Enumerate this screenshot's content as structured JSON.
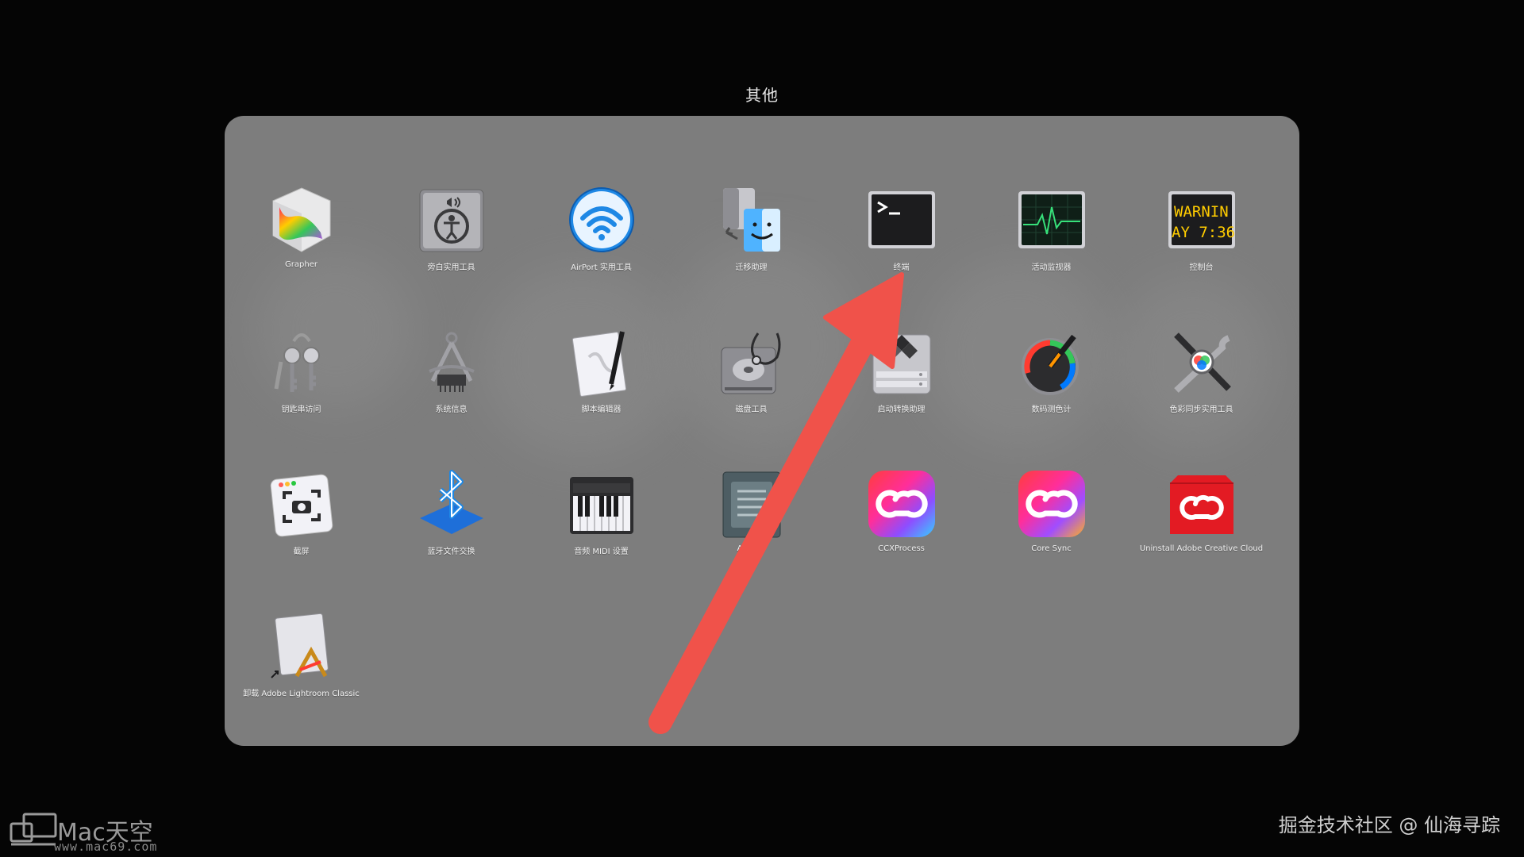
{
  "folder": {
    "title": "其他"
  },
  "apps": [
    {
      "label": "Grapher",
      "icon": "grapher-icon"
    },
    {
      "label": "旁白实用工具",
      "icon": "voiceover-utility-icon"
    },
    {
      "label": "AirPort 实用工具",
      "icon": "airport-utility-icon"
    },
    {
      "label": "迁移助理",
      "icon": "migration-assistant-icon"
    },
    {
      "label": "终端",
      "icon": "terminal-icon"
    },
    {
      "label": "活动监视器",
      "icon": "activity-monitor-icon"
    },
    {
      "label": "控制台",
      "icon": "console-icon",
      "text_top": "WARNIN",
      "text_bottom": "AY 7:36"
    },
    {
      "label": "钥匙串访问",
      "icon": "keychain-access-icon"
    },
    {
      "label": "系统信息",
      "icon": "system-information-icon"
    },
    {
      "label": "脚本编辑器",
      "icon": "script-editor-icon"
    },
    {
      "label": "磁盘工具",
      "icon": "disk-utility-icon"
    },
    {
      "label": "启动转换助理",
      "icon": "boot-camp-assistant-icon"
    },
    {
      "label": "数码测色计",
      "icon": "digital-color-meter-icon"
    },
    {
      "label": "色彩同步实用工具",
      "icon": "colorsync-utility-icon"
    },
    {
      "label": "截屏",
      "icon": "screenshot-icon"
    },
    {
      "label": "蓝牙文件交换",
      "icon": "bluetooth-file-exchange-icon"
    },
    {
      "label": "音频 MIDI 设置",
      "icon": "audio-midi-setup-icon"
    },
    {
      "label": "A        roker",
      "icon": "adobe-broker-icon"
    },
    {
      "label": "CCXProcess",
      "icon": "ccxprocess-icon"
    },
    {
      "label": "Core Sync",
      "icon": "core-sync-icon"
    },
    {
      "label": "Uninstall Adobe Creative Cloud",
      "icon": "uninstall-creative-cloud-icon"
    },
    {
      "label": "卸载 Adobe Lightroom Classic",
      "icon": "uninstall-lightroom-icon"
    }
  ],
  "annotation": {
    "color": "#f0524a",
    "points_to": "终端"
  },
  "watermark_left": {
    "logo": "Mac天空",
    "url": "www.mac69.com"
  },
  "watermark_right": {
    "text": "掘金技术社区 @ 仙海寻踪"
  }
}
